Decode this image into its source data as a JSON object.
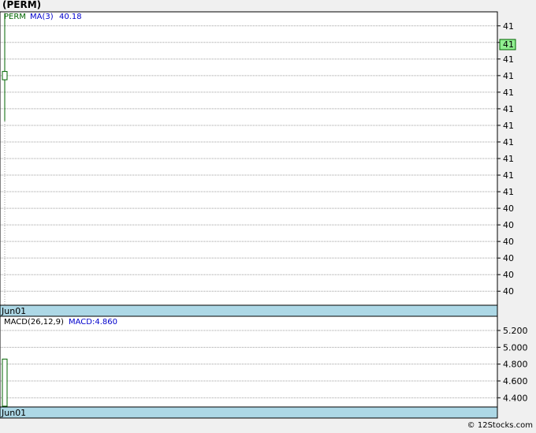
{
  "title": "(PERM)",
  "footer": "© 12Stocks.com",
  "colors": {
    "background": "#f0f0f0",
    "panel": "#ffffff",
    "axis_bar": "#add8e6",
    "grid": "#a0a0a0",
    "price": "#006400",
    "label_blue": "#0000cc",
    "current_price_box": "#90ee90"
  },
  "chart_data": [
    {
      "type": "candlestick",
      "legend": {
        "symbol": "PERM",
        "ma_label": "MA(3)",
        "ma_value": "40.18"
      },
      "x_label": "Jun01",
      "y_tick_labels": [
        "41",
        "41",
        "41",
        "41",
        "41",
        "41",
        "41",
        "41",
        "41",
        "41",
        "41",
        "40",
        "40",
        "40",
        "40",
        "40",
        "40"
      ],
      "y_ticks": [
        41.22,
        41.18,
        41.14,
        41.1,
        41.06,
        41.02,
        40.98,
        40.94,
        40.9,
        40.86,
        40.82,
        40.78,
        40.74,
        40.7,
        40.66,
        40.62,
        40.58
      ],
      "ylim": [
        40.55,
        41.25
      ],
      "current_price": {
        "label": "41",
        "value": 41.11
      },
      "candles": [
        {
          "date": "Jun01",
          "open": 41.09,
          "close": 41.11,
          "high": 41.25,
          "low": 40.99
        }
      ],
      "grid": true
    },
    {
      "type": "bar",
      "legend": {
        "name": "MACD(26,12,9)",
        "value_label": "MACD:4.860"
      },
      "x_label": "Jun01",
      "y_tick_labels": [
        "5.200",
        "5.000",
        "4.800",
        "4.600",
        "4.400"
      ],
      "y_ticks": [
        5.2,
        5.0,
        4.8,
        4.6,
        4.4
      ],
      "ylim": [
        4.3,
        5.35
      ],
      "bars": [
        {
          "date": "Jun01",
          "value": 4.86
        }
      ],
      "grid": true
    }
  ]
}
